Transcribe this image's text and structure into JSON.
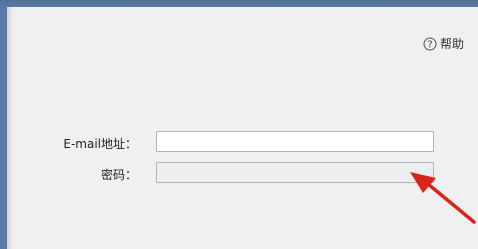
{
  "help": {
    "label": "帮助"
  },
  "form": {
    "email": {
      "label": "E-mail地址：",
      "value": ""
    },
    "password": {
      "label": "密码：",
      "value": ""
    }
  },
  "colors": {
    "title_bar": "#5a7ba6",
    "dialog_bg": "#f0f0f0",
    "input_border": "#9fb7c9",
    "arrow": "#d9251c"
  }
}
